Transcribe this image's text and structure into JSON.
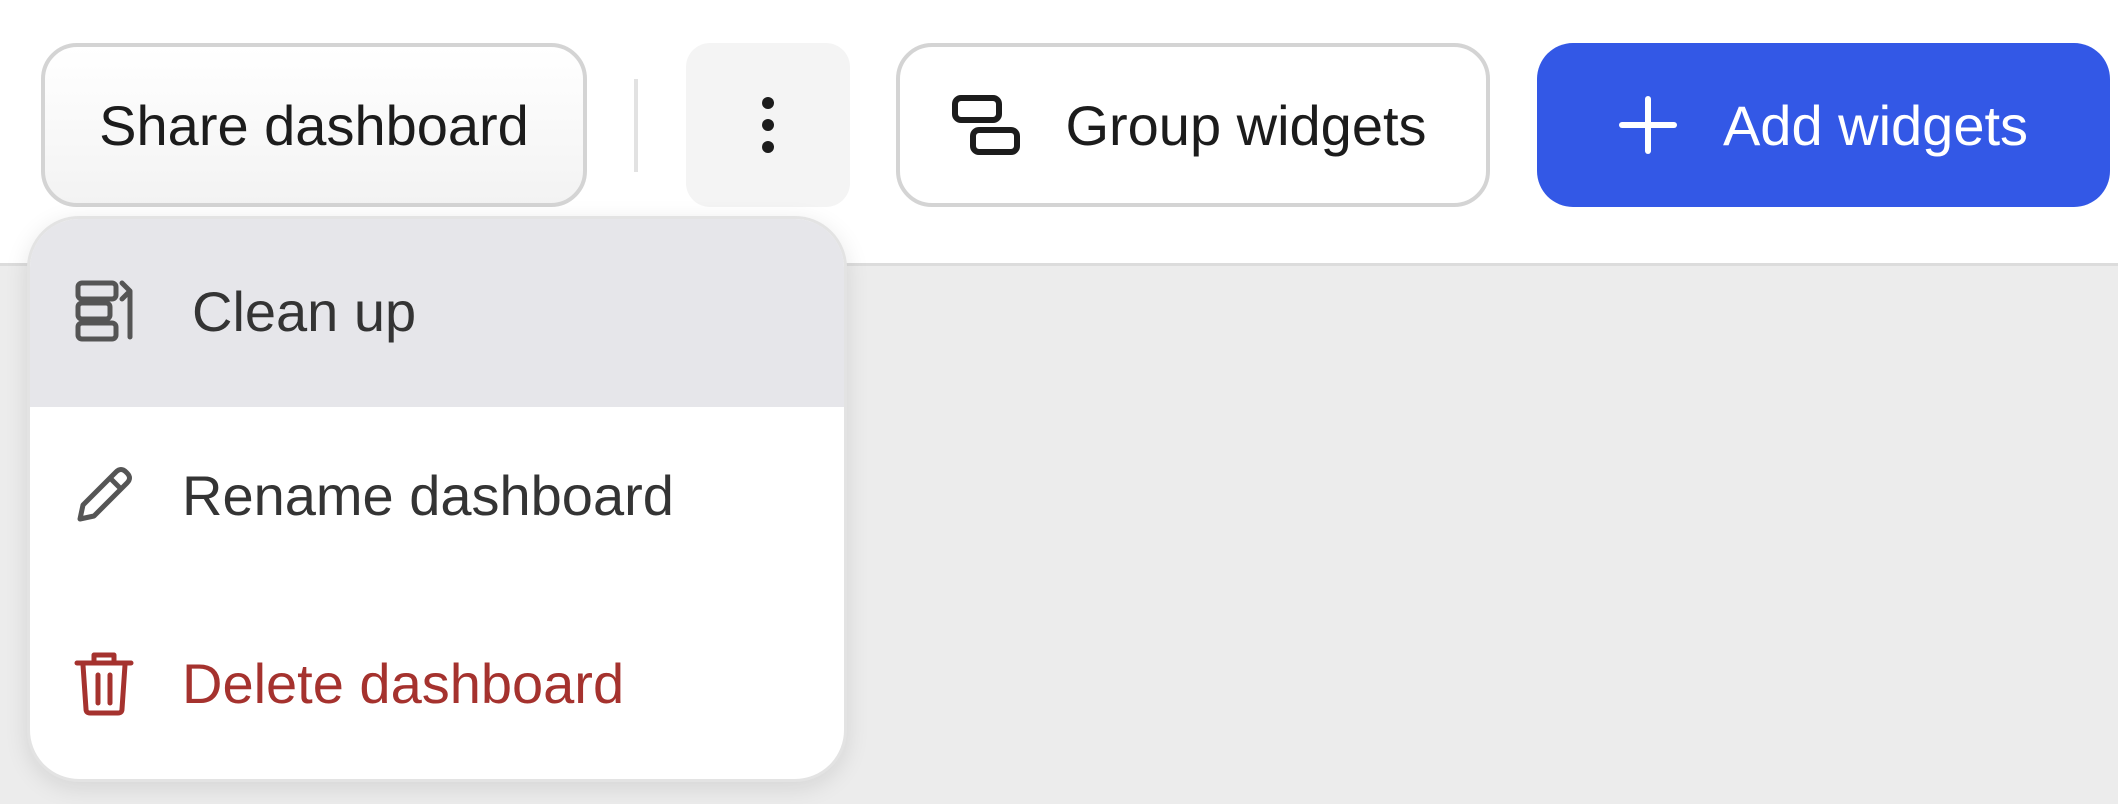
{
  "toolbar": {
    "share_label": "Share dashboard",
    "group_label": "Group widgets",
    "add_label": "Add widgets"
  },
  "menu": {
    "items": [
      {
        "label": "Clean up",
        "icon": "clean-up-icon"
      },
      {
        "label": "Rename dashboard",
        "icon": "pencil-icon"
      },
      {
        "label": "Delete dashboard",
        "icon": "trash-icon"
      }
    ]
  },
  "colors": {
    "accent": "#3358e6",
    "danger": "#a5322e",
    "highlight": "#e6e6ea"
  }
}
